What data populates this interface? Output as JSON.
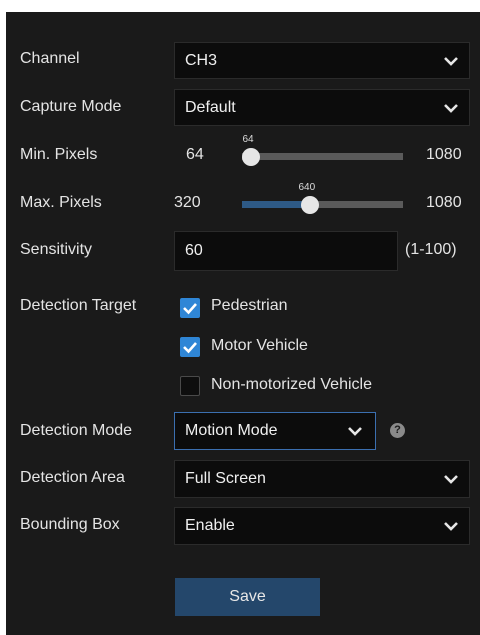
{
  "channel": {
    "label": "Channel",
    "value": "CH3"
  },
  "capture_mode": {
    "label": "Capture Mode",
    "value": "Default"
  },
  "min_pixels": {
    "label": "Min. Pixels",
    "min": "64",
    "max": "1080",
    "value": "64",
    "fraction": 0.0
  },
  "max_pixels": {
    "label": "Max. Pixels",
    "min": "320",
    "max": "1080",
    "value": "640",
    "fraction": 0.42
  },
  "sensitivity": {
    "label": "Sensitivity",
    "value": "60",
    "range": "(1-100)"
  },
  "detection_target": {
    "label": "Detection Target",
    "options": [
      {
        "label": "Pedestrian",
        "checked": true
      },
      {
        "label": "Motor Vehicle",
        "checked": true
      },
      {
        "label": "Non-motorized Vehicle",
        "checked": false
      }
    ]
  },
  "detection_mode": {
    "label": "Detection Mode",
    "value": "Motion Mode",
    "help": "?"
  },
  "detection_area": {
    "label": "Detection Area",
    "value": "Full Screen"
  },
  "bounding_box": {
    "label": "Bounding Box",
    "value": "Enable"
  },
  "save_label": "Save",
  "colors": {
    "panel": "#1a1a1a",
    "field": "#0c0c0c",
    "accent": "#2f86d6",
    "button": "#24476b",
    "slider_fill": "#2e5a86"
  },
  "icons": {
    "dropdown": "chevron-down-icon",
    "checkbox": "checkmark-icon",
    "help": "question-circle-icon"
  }
}
